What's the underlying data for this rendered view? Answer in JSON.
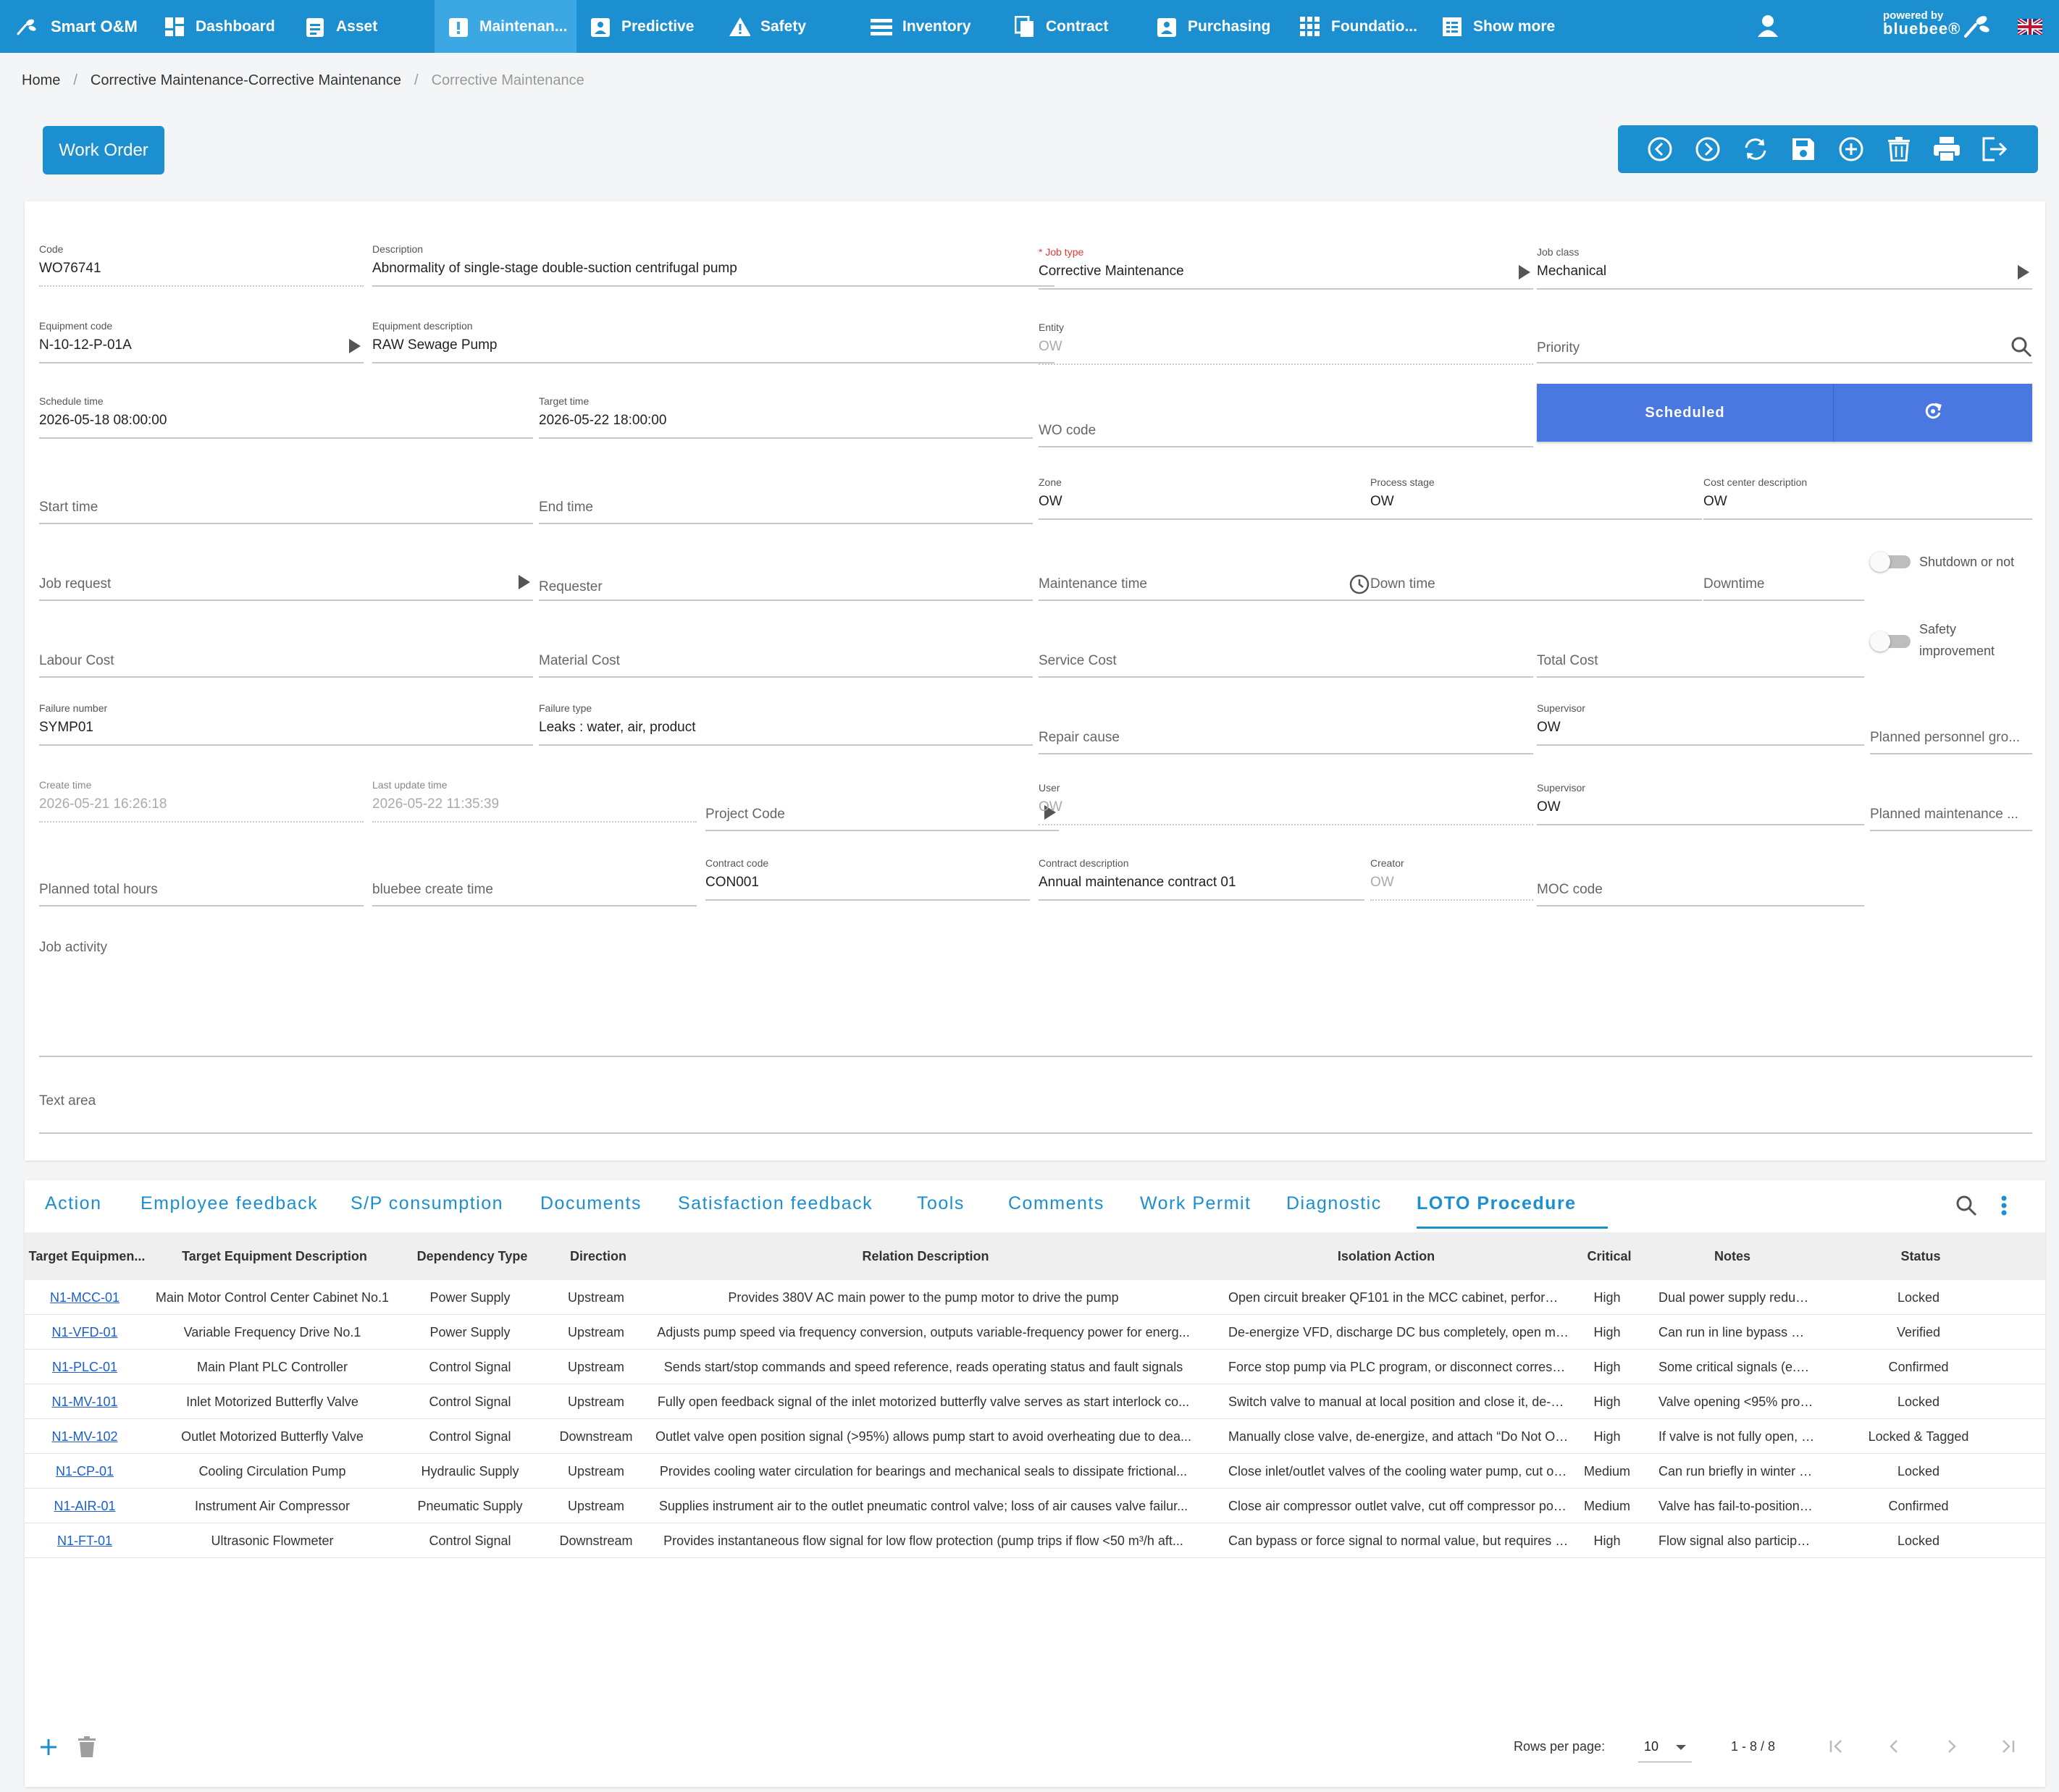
{
  "app": {
    "name": "Smart O&M",
    "powered_by": "powered by",
    "brand": "bluebee®"
  },
  "nav": [
    {
      "label": "Dashboard",
      "icon": "dashboard-icon"
    },
    {
      "label": "Asset",
      "icon": "asset-icon"
    },
    {
      "label": "Maintenan...",
      "icon": "maintenance-icon",
      "active": true
    },
    {
      "label": "Predictive",
      "icon": "predictive-icon"
    },
    {
      "label": "Safety",
      "icon": "warning-icon"
    },
    {
      "label": "Inventory",
      "icon": "inventory-icon"
    },
    {
      "label": "Contract",
      "icon": "contract-icon"
    },
    {
      "label": "Purchasing",
      "icon": "purchasing-icon"
    },
    {
      "label": "Foundatio...",
      "icon": "grid-icon"
    },
    {
      "label": "Show more",
      "icon": "show-more-icon"
    }
  ],
  "breadcrumb": [
    "Home",
    "Corrective Maintenance-Corrective Maintenance",
    "Corrective Maintenance"
  ],
  "work_order_button": "Work Order",
  "toolbar": [
    "previous-icon",
    "next-icon",
    "refresh-icon",
    "save-icon",
    "add-icon",
    "delete-icon",
    "print-icon",
    "exit-icon"
  ],
  "form": {
    "code": {
      "label": "Code",
      "value": "WO76741"
    },
    "description": {
      "label": "Description",
      "value": "Abnormality of single-stage double-suction centrifugal pump"
    },
    "job_type": {
      "label": "* Job type",
      "value": "Corrective Maintenance"
    },
    "job_class": {
      "label": "Job class",
      "value": "Mechanical"
    },
    "equipment_code": {
      "label": "Equipment code",
      "value": "N-10-12-P-01A"
    },
    "equipment_description": {
      "label": "Equipment description",
      "value": "RAW Sewage Pump"
    },
    "entity": {
      "label": "Entity",
      "value": "OW"
    },
    "priority": {
      "placeholder": "Priority"
    },
    "schedule_time": {
      "label": "Schedule time",
      "value": "2026-05-18 08:00:00"
    },
    "target_time": {
      "label": "Target time",
      "value": "2026-05-22 18:00:00"
    },
    "wo_code": {
      "placeholder": "WO code"
    },
    "status_button": "Scheduled",
    "start_time": {
      "placeholder": "Start time"
    },
    "end_time": {
      "placeholder": "End time"
    },
    "zone": {
      "label": "Zone",
      "value": "OW"
    },
    "process_stage": {
      "label": "Process stage",
      "value": "OW"
    },
    "cost_center_description": {
      "label": "Cost center description",
      "value": "OW"
    },
    "job_request": {
      "placeholder": "Job request"
    },
    "requester": {
      "placeholder": "Requester"
    },
    "maintenance_time": {
      "placeholder": "Maintenance time"
    },
    "down_time": {
      "placeholder": "Down time"
    },
    "downtime": {
      "placeholder": "Downtime"
    },
    "shutdown_toggle": {
      "label": "Shutdown or not",
      "on": false
    },
    "labour_cost": {
      "placeholder": "Labour Cost"
    },
    "material_cost": {
      "placeholder": "Material Cost"
    },
    "service_cost": {
      "placeholder": "Service Cost"
    },
    "total_cost": {
      "placeholder": "Total Cost"
    },
    "safety_toggle": {
      "label_line1": "Safety",
      "label_line2": "improvement",
      "on": false
    },
    "failure_number": {
      "label": "Failure number",
      "value": "SYMP01"
    },
    "failure_type": {
      "label": "Failure type",
      "value": "Leaks : water, air, product"
    },
    "repair_cause": {
      "placeholder": "Repair cause"
    },
    "supervisor_1": {
      "label": "Supervisor",
      "value": "OW"
    },
    "planned_personnel_group": {
      "placeholder": "Planned personnel gro..."
    },
    "create_time": {
      "label": "Create time",
      "value": "2026-05-21 16:26:18"
    },
    "last_update_time": {
      "label": "Last update time",
      "value": "2026-05-22 11:35:39"
    },
    "project_code": {
      "placeholder": "Project Code"
    },
    "user": {
      "label": "User",
      "value": "OW"
    },
    "supervisor_2": {
      "label": "Supervisor",
      "value": "OW"
    },
    "planned_maintenance": {
      "placeholder": "Planned maintenance ..."
    },
    "planned_total_hours": {
      "placeholder": "Planned total hours"
    },
    "bluebee_create_time": {
      "placeholder": "bluebee create time"
    },
    "contract_code": {
      "label": "Contract code",
      "value": "CON001"
    },
    "contract_description": {
      "label": "Contract description",
      "value": "Annual maintenance contract 01"
    },
    "creator": {
      "label": "Creator",
      "value": "OW"
    },
    "moc_code": {
      "placeholder": "MOC code"
    },
    "job_activity": {
      "placeholder": "Job activity"
    },
    "text_area": {
      "placeholder": "Text area"
    }
  },
  "tabs": [
    "Action",
    "Employee feedback",
    "S/P consumption",
    "Documents",
    "Satisfaction feedback",
    "Tools",
    "Comments",
    "Work Permit",
    "Diagnostic",
    "LOTO Procedure"
  ],
  "active_tab": "LOTO Procedure",
  "table": {
    "columns": [
      "Target Equipmen...",
      "Target Equipment Description",
      "Dependency Type",
      "Direction",
      "Relation Description",
      "Isolation Action",
      "Critical",
      "Notes",
      "Status"
    ],
    "rows": [
      [
        "N1-MCC-01",
        "Main Motor Control Center Cabinet No.1",
        "Power Supply",
        "Upstream",
        "Provides 380V AC main power to the pump motor to drive the pump",
        "Open circuit breaker QF101 in the MCC cabinet, perform LOT...",
        "High",
        "Dual power supply redund...",
        "Locked"
      ],
      [
        "N1-VFD-01",
        "Variable Frequency Drive No.1",
        "Power Supply",
        "Upstream",
        "Adjusts pump speed via frequency conversion, outputs variable-frequency power for energ...",
        "De-energize VFD, discharge DC bus completely, open main cir...",
        "High",
        "Can run in line bypass mo...",
        "Verified"
      ],
      [
        "N1-PLC-01",
        "Main Plant PLC Controller",
        "Control Signal",
        "Upstream",
        "Sends start/stop commands and speed reference, reads operating status and fault signals",
        "Force stop pump via PLC program, or disconnect correspondi...",
        "High",
        "Some critical signals (e.g.,...",
        "Confirmed"
      ],
      [
        "N1-MV-101",
        "Inlet Motorized Butterfly Valve",
        "Control Signal",
        "Upstream",
        "Fully open feedback signal of the inlet motorized butterfly valve serves as start interlock co...",
        "Switch valve to manual at local position and close it, de-energ...",
        "High",
        "Valve opening <95% prohi...",
        "Locked"
      ],
      [
        "N1-MV-102",
        "Outlet Motorized Butterfly Valve",
        "Control Signal",
        "Downstream",
        "Outlet valve open position signal (>95%) allows pump start to avoid overheating due to dea...",
        "Manually close valve, de-energize, and attach “Do Not Operat...",
        "High",
        "If valve is not fully open, p...",
        "Locked & Tagged"
      ],
      [
        "N1-CP-01",
        "Cooling Circulation Pump",
        "Hydraulic Supply",
        "Upstream",
        "Provides cooling water circulation for bearings and mechanical seals to dissipate frictional...",
        "Close inlet/outlet valves of the cooling water pump, cut off its...",
        "Medium",
        "Can run briefly in winter (<...",
        "Locked"
      ],
      [
        "N1-AIR-01",
        "Instrument Air Compressor",
        "Pneumatic Supply",
        "Upstream",
        "Supplies instrument air to the outlet pneumatic control valve; loss of air causes valve failur...",
        "Close air compressor outlet valve, cut off compressor power, ...",
        "Medium",
        "Valve has fail-to-position f...",
        "Confirmed"
      ],
      [
        "N1-FT-01",
        "Ultrasonic Flowmeter",
        "Control Signal",
        "Downstream",
        "Provides instantaneous flow signal for low flow protection (pump trips if flow <50 m³/h aft...",
        "Can bypass or force signal to normal value, but requires proc...",
        "High",
        "Flow signal also participat...",
        "Locked"
      ]
    ]
  },
  "pagination": {
    "rows_per_page_label": "Rows per page:",
    "rows_per_page": "10",
    "range": "1 - 8 / 8"
  },
  "colors": {
    "primary": "#1b8fd0",
    "status_button": "#4a78e0",
    "link": "#1b5ed0",
    "required": "#e53935"
  }
}
